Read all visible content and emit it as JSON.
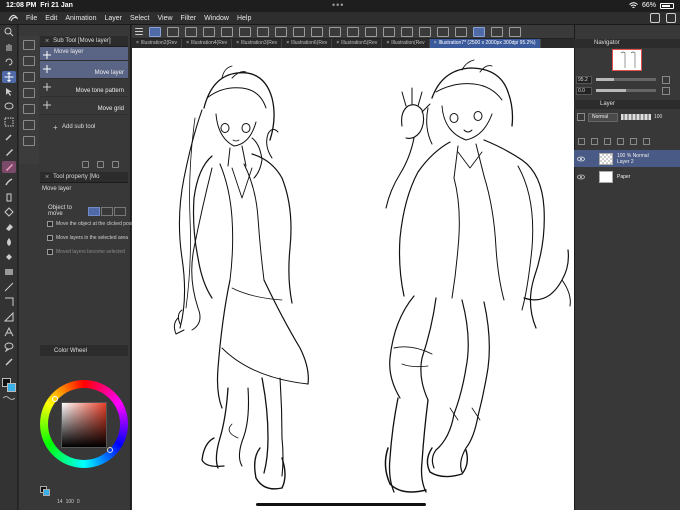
{
  "status": {
    "time": "12:08 PM",
    "date": "Fri 21 Jan",
    "battery": "66%"
  },
  "menu": [
    "File",
    "Edit",
    "Animation",
    "Layer",
    "Select",
    "View",
    "Filter",
    "Window",
    "Help"
  ],
  "subtool": {
    "header": "Sub Tool [Move layer]",
    "items": [
      "Move layer",
      "Move layer",
      "Move tone pattern",
      "Move grid"
    ],
    "selected_index": 1,
    "add_label": "Add sub tool"
  },
  "toolprop": {
    "header": "Tool property [Mo",
    "title": "Move layer",
    "object_to_move_label": "Object to move",
    "options": [
      {
        "label": "Move the object at the clicked position",
        "checked": false,
        "enabled": true
      },
      {
        "label": "Move layers in the selected area",
        "checked": false,
        "enabled": true
      },
      {
        "label": "Moved layers become selected",
        "checked": false,
        "enabled": false
      }
    ]
  },
  "colorwheel": {
    "header": "Color Wheel",
    "hue_color": "#e8402a",
    "main_color": "#111111",
    "sub_color": "#3ab0e8",
    "bottom_values": [
      "14",
      "100",
      "0"
    ]
  },
  "tabs": [
    {
      "label": "Illustration2(Rev",
      "active": false
    },
    {
      "label": "Illustration4(Rev",
      "active": false
    },
    {
      "label": "Illustration3(Rev",
      "active": false
    },
    {
      "label": "Illustration6(Rev",
      "active": false
    },
    {
      "label": "Illustration5(Rev",
      "active": false
    },
    {
      "label": "Illustration(Rev",
      "active": false
    },
    {
      "label": "Illustration7* (2500 x 2000px 300dpi 95.2%)",
      "active": true
    }
  ],
  "navigator": {
    "header": "Navigator",
    "zoom": "95.2",
    "rotation": "0.0",
    "zoom_level": 0.3,
    "rotation_level": 0.5
  },
  "layer": {
    "header": "Layer",
    "blend_mode": "Normal",
    "opacity": "100",
    "rows": [
      {
        "line1": "100 % Normal",
        "line2": "Layer 2",
        "selected": true,
        "thumb": "checker"
      },
      {
        "line1": "",
        "line2": "Paper",
        "selected": false,
        "thumb": "white"
      }
    ]
  }
}
